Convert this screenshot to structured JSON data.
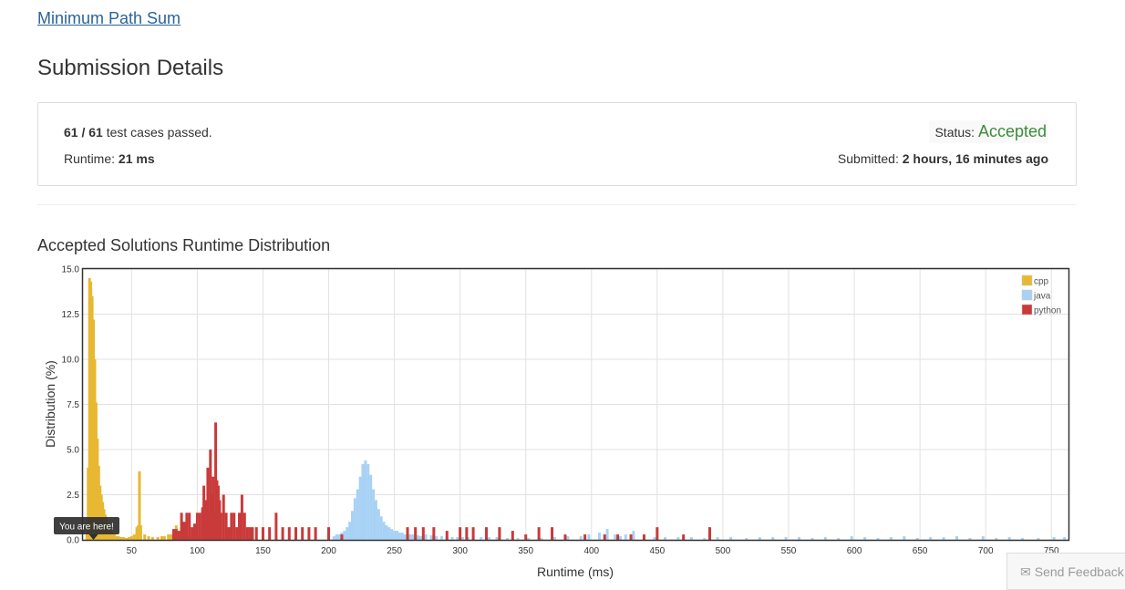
{
  "problem": {
    "title": "Minimum Path Sum"
  },
  "page": {
    "title": "Submission Details"
  },
  "result": {
    "passed": "61",
    "separator": " / ",
    "total": "61",
    "testcases_suffix": " test cases passed.",
    "runtime_label": "Runtime: ",
    "runtime_value": "21 ms",
    "status_label": "Status: ",
    "status_value": "Accepted",
    "submitted_label": "Submitted: ",
    "submitted_value": "2 hours, 16 minutes ago"
  },
  "distribution": {
    "heading": "Accepted Solutions Runtime Distribution"
  },
  "feedback": {
    "label": "Send Feedback",
    "icon": "envelope-icon"
  },
  "colors": {
    "cpp": "#e8b832",
    "java": "#a8d2f5",
    "python": "#c93a3a",
    "accepted": "#3c8b3c",
    "link": "#2a6496"
  },
  "chart_data": {
    "type": "bar",
    "xlabel": "Runtime (ms)",
    "ylabel": "Distribution (%)",
    "xlim": [
      13,
      763
    ],
    "ylim": [
      0,
      15
    ],
    "x_ticks": [
      50,
      100,
      150,
      200,
      250,
      300,
      350,
      400,
      450,
      500,
      550,
      600,
      650,
      700,
      750
    ],
    "y_ticks": [
      "0.0",
      "2.5",
      "5.0",
      "7.5",
      "10.0",
      "12.5",
      "15.0"
    ],
    "grid": true,
    "legend_position": "top-right",
    "marker": {
      "x": 21,
      "label": "You are here!"
    },
    "series": [
      {
        "name": "cpp",
        "color": "#e8b832",
        "points": [
          [
            16,
            0.3
          ],
          [
            17,
            4.0
          ],
          [
            18,
            14.5
          ],
          [
            19,
            14.3
          ],
          [
            20,
            13.5
          ],
          [
            21,
            12.2
          ],
          [
            22,
            10.0
          ],
          [
            23,
            7.6
          ],
          [
            24,
            5.6
          ],
          [
            25,
            4.1
          ],
          [
            26,
            3.0
          ],
          [
            27,
            2.5
          ],
          [
            28,
            2.1
          ],
          [
            29,
            1.7
          ],
          [
            30,
            1.4
          ],
          [
            31,
            1.1
          ],
          [
            32,
            0.8
          ],
          [
            33,
            0.6
          ],
          [
            34,
            0.5
          ],
          [
            35,
            0.4
          ],
          [
            36,
            0.3
          ],
          [
            37,
            0.3
          ],
          [
            38,
            0.2
          ],
          [
            40,
            0.2
          ],
          [
            42,
            0.15
          ],
          [
            44,
            0.15
          ],
          [
            46,
            0.1
          ],
          [
            48,
            0.15
          ],
          [
            50,
            0.2
          ],
          [
            52,
            0.3
          ],
          [
            54,
            0.7
          ],
          [
            55,
            0.8
          ],
          [
            56,
            3.8
          ],
          [
            57,
            0.8
          ],
          [
            60,
            0.3
          ],
          [
            63,
            0.2
          ],
          [
            66,
            0.15
          ],
          [
            70,
            0.15
          ],
          [
            73,
            0.2
          ],
          [
            75,
            0.2
          ],
          [
            78,
            0.3
          ],
          [
            80,
            0.3
          ],
          [
            82,
            0.25
          ],
          [
            84,
            0.8
          ],
          [
            86,
            0.4
          ],
          [
            88,
            0.6
          ],
          [
            90,
            0.4
          ],
          [
            92,
            0.3
          ],
          [
            94,
            0.2
          ],
          [
            96,
            0.2
          ],
          [
            98,
            0.2
          ],
          [
            100,
            0.3
          ],
          [
            102,
            0.3
          ],
          [
            104,
            0.4
          ],
          [
            106,
            0.3
          ],
          [
            108,
            0.3
          ],
          [
            110,
            0.3
          ],
          [
            112,
            0.2
          ],
          [
            114,
            0.15
          ],
          [
            116,
            0.15
          ],
          [
            118,
            0.1
          ],
          [
            120,
            0.1
          ]
        ]
      },
      {
        "name": "java",
        "color": "#a8d2f5",
        "points": [
          [
            204,
            0.2
          ],
          [
            206,
            0.3
          ],
          [
            208,
            0.3
          ],
          [
            210,
            0.4
          ],
          [
            212,
            0.5
          ],
          [
            214,
            0.7
          ],
          [
            216,
            1.0
          ],
          [
            218,
            1.6
          ],
          [
            220,
            2.3
          ],
          [
            222,
            2.8
          ],
          [
            224,
            3.5
          ],
          [
            226,
            4.2
          ],
          [
            228,
            4.4
          ],
          [
            230,
            4.2
          ],
          [
            232,
            3.6
          ],
          [
            234,
            2.8
          ],
          [
            236,
            2.2
          ],
          [
            238,
            1.7
          ],
          [
            240,
            1.3
          ],
          [
            242,
            1.0
          ],
          [
            244,
            0.8
          ],
          [
            246,
            0.7
          ],
          [
            248,
            0.6
          ],
          [
            250,
            0.5
          ],
          [
            252,
            0.5
          ],
          [
            254,
            0.4
          ],
          [
            256,
            0.4
          ],
          [
            258,
            0.3
          ],
          [
            260,
            0.3
          ],
          [
            262,
            0.3
          ],
          [
            264,
            0.3
          ],
          [
            266,
            0.25
          ],
          [
            268,
            0.25
          ],
          [
            270,
            0.2
          ],
          [
            274,
            0.3
          ],
          [
            278,
            0.25
          ],
          [
            282,
            0.2
          ],
          [
            286,
            0.2
          ],
          [
            290,
            0.2
          ],
          [
            294,
            0.15
          ],
          [
            298,
            0.15
          ],
          [
            302,
            0.15
          ],
          [
            306,
            0.15
          ],
          [
            310,
            0.15
          ],
          [
            316,
            0.15
          ],
          [
            322,
            0.15
          ],
          [
            328,
            0.15
          ],
          [
            336,
            0.1
          ],
          [
            344,
            0.1
          ],
          [
            352,
            0.1
          ],
          [
            362,
            0.1
          ],
          [
            372,
            0.15
          ],
          [
            382,
            0.2
          ],
          [
            392,
            0.2
          ],
          [
            398,
            0.3
          ],
          [
            406,
            0.4
          ],
          [
            412,
            0.6
          ],
          [
            418,
            0.3
          ],
          [
            422,
            0.2
          ],
          [
            426,
            0.3
          ],
          [
            432,
            0.5
          ],
          [
            440,
            0.2
          ],
          [
            448,
            0.15
          ],
          [
            456,
            0.15
          ],
          [
            466,
            0.15
          ],
          [
            476,
            0.15
          ],
          [
            486,
            0.1
          ],
          [
            496,
            0.15
          ],
          [
            506,
            0.15
          ],
          [
            518,
            0.1
          ],
          [
            528,
            0.15
          ],
          [
            538,
            0.15
          ],
          [
            548,
            0.15
          ],
          [
            558,
            0.15
          ],
          [
            568,
            0.1
          ],
          [
            578,
            0.15
          ],
          [
            588,
            0.1
          ],
          [
            598,
            0.2
          ],
          [
            608,
            0.15
          ],
          [
            618,
            0.1
          ],
          [
            628,
            0.15
          ],
          [
            638,
            0.2
          ],
          [
            648,
            0.1
          ],
          [
            658,
            0.15
          ],
          [
            668,
            0.15
          ],
          [
            678,
            0.2
          ],
          [
            688,
            0.1
          ],
          [
            698,
            0.2
          ],
          [
            708,
            0.1
          ],
          [
            718,
            0.15
          ],
          [
            728,
            0.1
          ],
          [
            740,
            0.1
          ],
          [
            752,
            0.15
          ],
          [
            760,
            0.15
          ]
        ]
      },
      {
        "name": "python",
        "color": "#c93a3a",
        "points": [
          [
            82,
            0.6
          ],
          [
            84,
            0.6
          ],
          [
            86,
            0.5
          ],
          [
            88,
            1.5
          ],
          [
            90,
            1.0
          ],
          [
            92,
            1.5
          ],
          [
            94,
            1.5
          ],
          [
            96,
            0.7
          ],
          [
            98,
            0.9
          ],
          [
            100,
            1.5
          ],
          [
            102,
            1.5
          ],
          [
            104,
            1.8
          ],
          [
            105,
            3.0
          ],
          [
            106,
            0.7
          ],
          [
            107,
            2.2
          ],
          [
            108,
            4.0
          ],
          [
            109,
            1.5
          ],
          [
            110,
            5.0
          ],
          [
            111,
            2.5
          ],
          [
            112,
            3.5
          ],
          [
            113,
            1.5
          ],
          [
            114,
            6.5
          ],
          [
            115,
            3.3
          ],
          [
            116,
            3.0
          ],
          [
            117,
            2.2
          ],
          [
            118,
            1.5
          ],
          [
            120,
            2.5
          ],
          [
            122,
            1.5
          ],
          [
            124,
            0.7
          ],
          [
            126,
            1.5
          ],
          [
            128,
            1.5
          ],
          [
            130,
            0.7
          ],
          [
            132,
            1.5
          ],
          [
            134,
            2.5
          ],
          [
            136,
            1.5
          ],
          [
            138,
            0.7
          ],
          [
            140,
            0.7
          ],
          [
            142,
            0.7
          ],
          [
            145,
            0.7
          ],
          [
            150,
            0.7
          ],
          [
            155,
            0.7
          ],
          [
            160,
            1.5
          ],
          [
            165,
            0.7
          ],
          [
            170,
            0.7
          ],
          [
            175,
            0.7
          ],
          [
            180,
            0.7
          ],
          [
            185,
            0.7
          ],
          [
            190,
            0.7
          ],
          [
            200,
            0.7
          ],
          [
            210,
            0.3
          ],
          [
            260,
            0.7
          ],
          [
            266,
            0.7
          ],
          [
            272,
            0.7
          ],
          [
            280,
            0.7
          ],
          [
            290,
            0.5
          ],
          [
            300,
            0.7
          ],
          [
            305,
            0.7
          ],
          [
            310,
            0.7
          ],
          [
            320,
            0.7
          ],
          [
            330,
            0.7
          ],
          [
            340,
            0.5
          ],
          [
            350,
            0.3
          ],
          [
            360,
            0.7
          ],
          [
            370,
            0.7
          ],
          [
            380,
            0.3
          ],
          [
            395,
            0.3
          ],
          [
            410,
            0.3
          ],
          [
            420,
            0.3
          ],
          [
            430,
            0.3
          ],
          [
            440,
            0.3
          ],
          [
            450,
            0.7
          ],
          [
            470,
            0.3
          ],
          [
            490,
            0.7
          ]
        ]
      }
    ]
  }
}
